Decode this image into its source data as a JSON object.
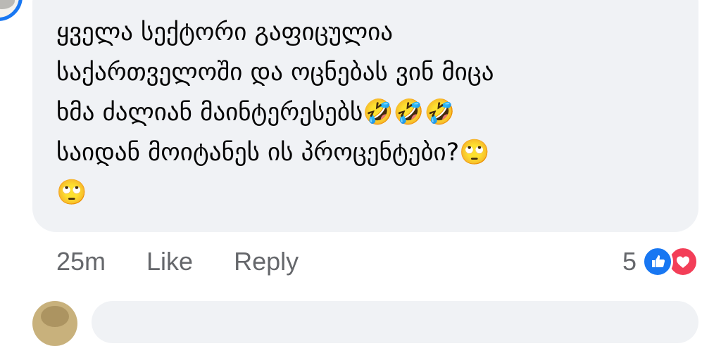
{
  "comment": {
    "text": "ყველა სექტორი გაფიცულია\nსაქართველოში და ოცნებას ვინ მიცა\nხმა ძალიან მაინტერესებს🤣🤣🤣\nსაიდან მოიტანეს ის პროცენტები?🙄\n🙄"
  },
  "actions": {
    "time": "25m",
    "like_label": "Like",
    "reply_label": "Reply"
  },
  "reactions": {
    "count": "5",
    "like_color": "#1877f2",
    "love_color": "#f33e58"
  },
  "colors": {
    "bubble": "#f0f2f5",
    "secondary_text": "#65676b",
    "avatar_ring": "#1877f2"
  }
}
